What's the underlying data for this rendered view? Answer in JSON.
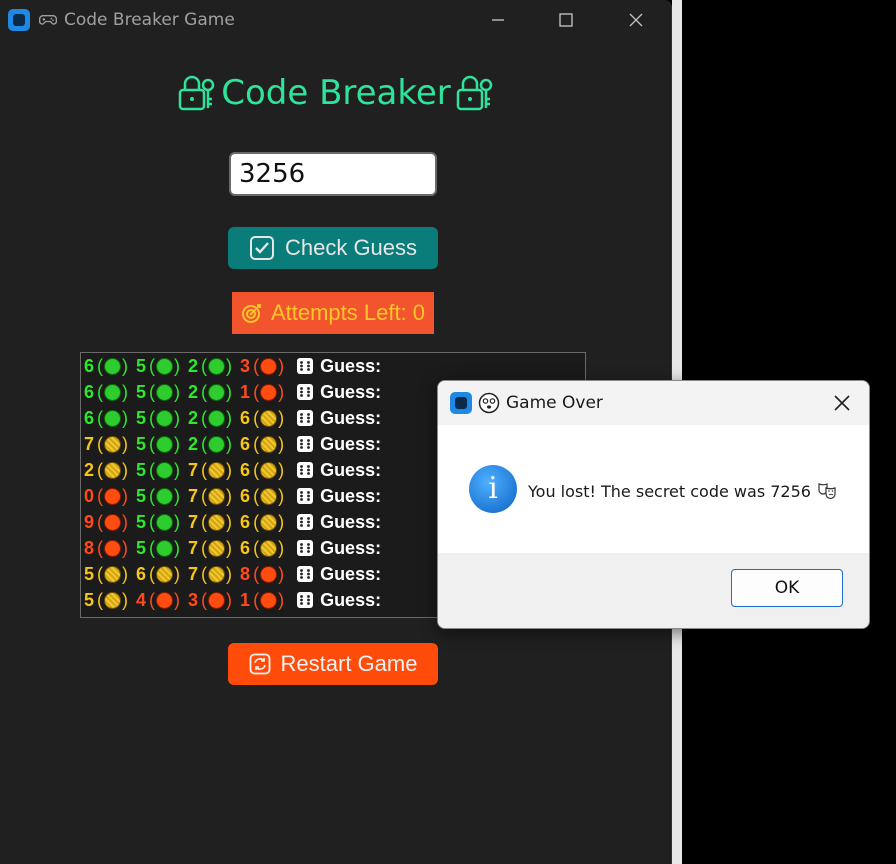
{
  "window": {
    "title": "Code Breaker Game",
    "app_icon": "app-icon",
    "title_emoji": "gamepad-icon",
    "controls": [
      "minimize",
      "maximize",
      "close"
    ]
  },
  "header": {
    "title": "Code Breaker",
    "icon": "lock-key-icon",
    "color": "#2ee39a"
  },
  "guess_input": {
    "value": "3256"
  },
  "check_button": {
    "label": "Check Guess",
    "icon": "check-box-icon",
    "color": "#0a7d7a"
  },
  "attempts": {
    "label": "Attempts Left: 0",
    "icon": "target-icon",
    "bg": "#f2552e",
    "fg": "#ffc52a"
  },
  "history": {
    "guess_label": "Guess:",
    "rows": [
      {
        "pegs": [
          {
            "digit": "6",
            "status": "green"
          },
          {
            "digit": "5",
            "status": "green"
          },
          {
            "digit": "2",
            "status": "green"
          },
          {
            "digit": "3",
            "status": "red"
          }
        ]
      },
      {
        "pegs": [
          {
            "digit": "6",
            "status": "green"
          },
          {
            "digit": "5",
            "status": "green"
          },
          {
            "digit": "2",
            "status": "green"
          },
          {
            "digit": "1",
            "status": "red"
          }
        ]
      },
      {
        "pegs": [
          {
            "digit": "6",
            "status": "green"
          },
          {
            "digit": "5",
            "status": "green"
          },
          {
            "digit": "2",
            "status": "green"
          },
          {
            "digit": "6",
            "status": "yellow"
          }
        ]
      },
      {
        "pegs": [
          {
            "digit": "7",
            "status": "yellow"
          },
          {
            "digit": "5",
            "status": "green"
          },
          {
            "digit": "2",
            "status": "green"
          },
          {
            "digit": "6",
            "status": "yellow"
          }
        ]
      },
      {
        "pegs": [
          {
            "digit": "2",
            "status": "yellow"
          },
          {
            "digit": "5",
            "status": "green"
          },
          {
            "digit": "7",
            "status": "yellow"
          },
          {
            "digit": "6",
            "status": "yellow"
          }
        ]
      },
      {
        "pegs": [
          {
            "digit": "0",
            "status": "red"
          },
          {
            "digit": "5",
            "status": "green"
          },
          {
            "digit": "7",
            "status": "yellow"
          },
          {
            "digit": "6",
            "status": "yellow"
          }
        ]
      },
      {
        "pegs": [
          {
            "digit": "9",
            "status": "red"
          },
          {
            "digit": "5",
            "status": "green"
          },
          {
            "digit": "7",
            "status": "yellow"
          },
          {
            "digit": "6",
            "status": "yellow"
          }
        ]
      },
      {
        "pegs": [
          {
            "digit": "8",
            "status": "red"
          },
          {
            "digit": "5",
            "status": "green"
          },
          {
            "digit": "7",
            "status": "yellow"
          },
          {
            "digit": "6",
            "status": "yellow"
          }
        ]
      },
      {
        "pegs": [
          {
            "digit": "5",
            "status": "yellow"
          },
          {
            "digit": "6",
            "status": "yellow"
          },
          {
            "digit": "7",
            "status": "yellow"
          },
          {
            "digit": "8",
            "status": "red"
          }
        ]
      },
      {
        "pegs": [
          {
            "digit": "5",
            "status": "yellow"
          },
          {
            "digit": "4",
            "status": "red"
          },
          {
            "digit": "3",
            "status": "red"
          },
          {
            "digit": "1",
            "status": "red"
          }
        ]
      }
    ]
  },
  "restart_button": {
    "label": "Restart Game",
    "icon": "restart-icon",
    "color": "#ff4c0a"
  },
  "dialog": {
    "title": "Game Over",
    "title_emoji": "dizzy-face-icon",
    "message": "You lost! The secret code was 7256",
    "message_emoji": "theater-masks-icon",
    "icon": "info-icon",
    "ok_label": "OK"
  }
}
